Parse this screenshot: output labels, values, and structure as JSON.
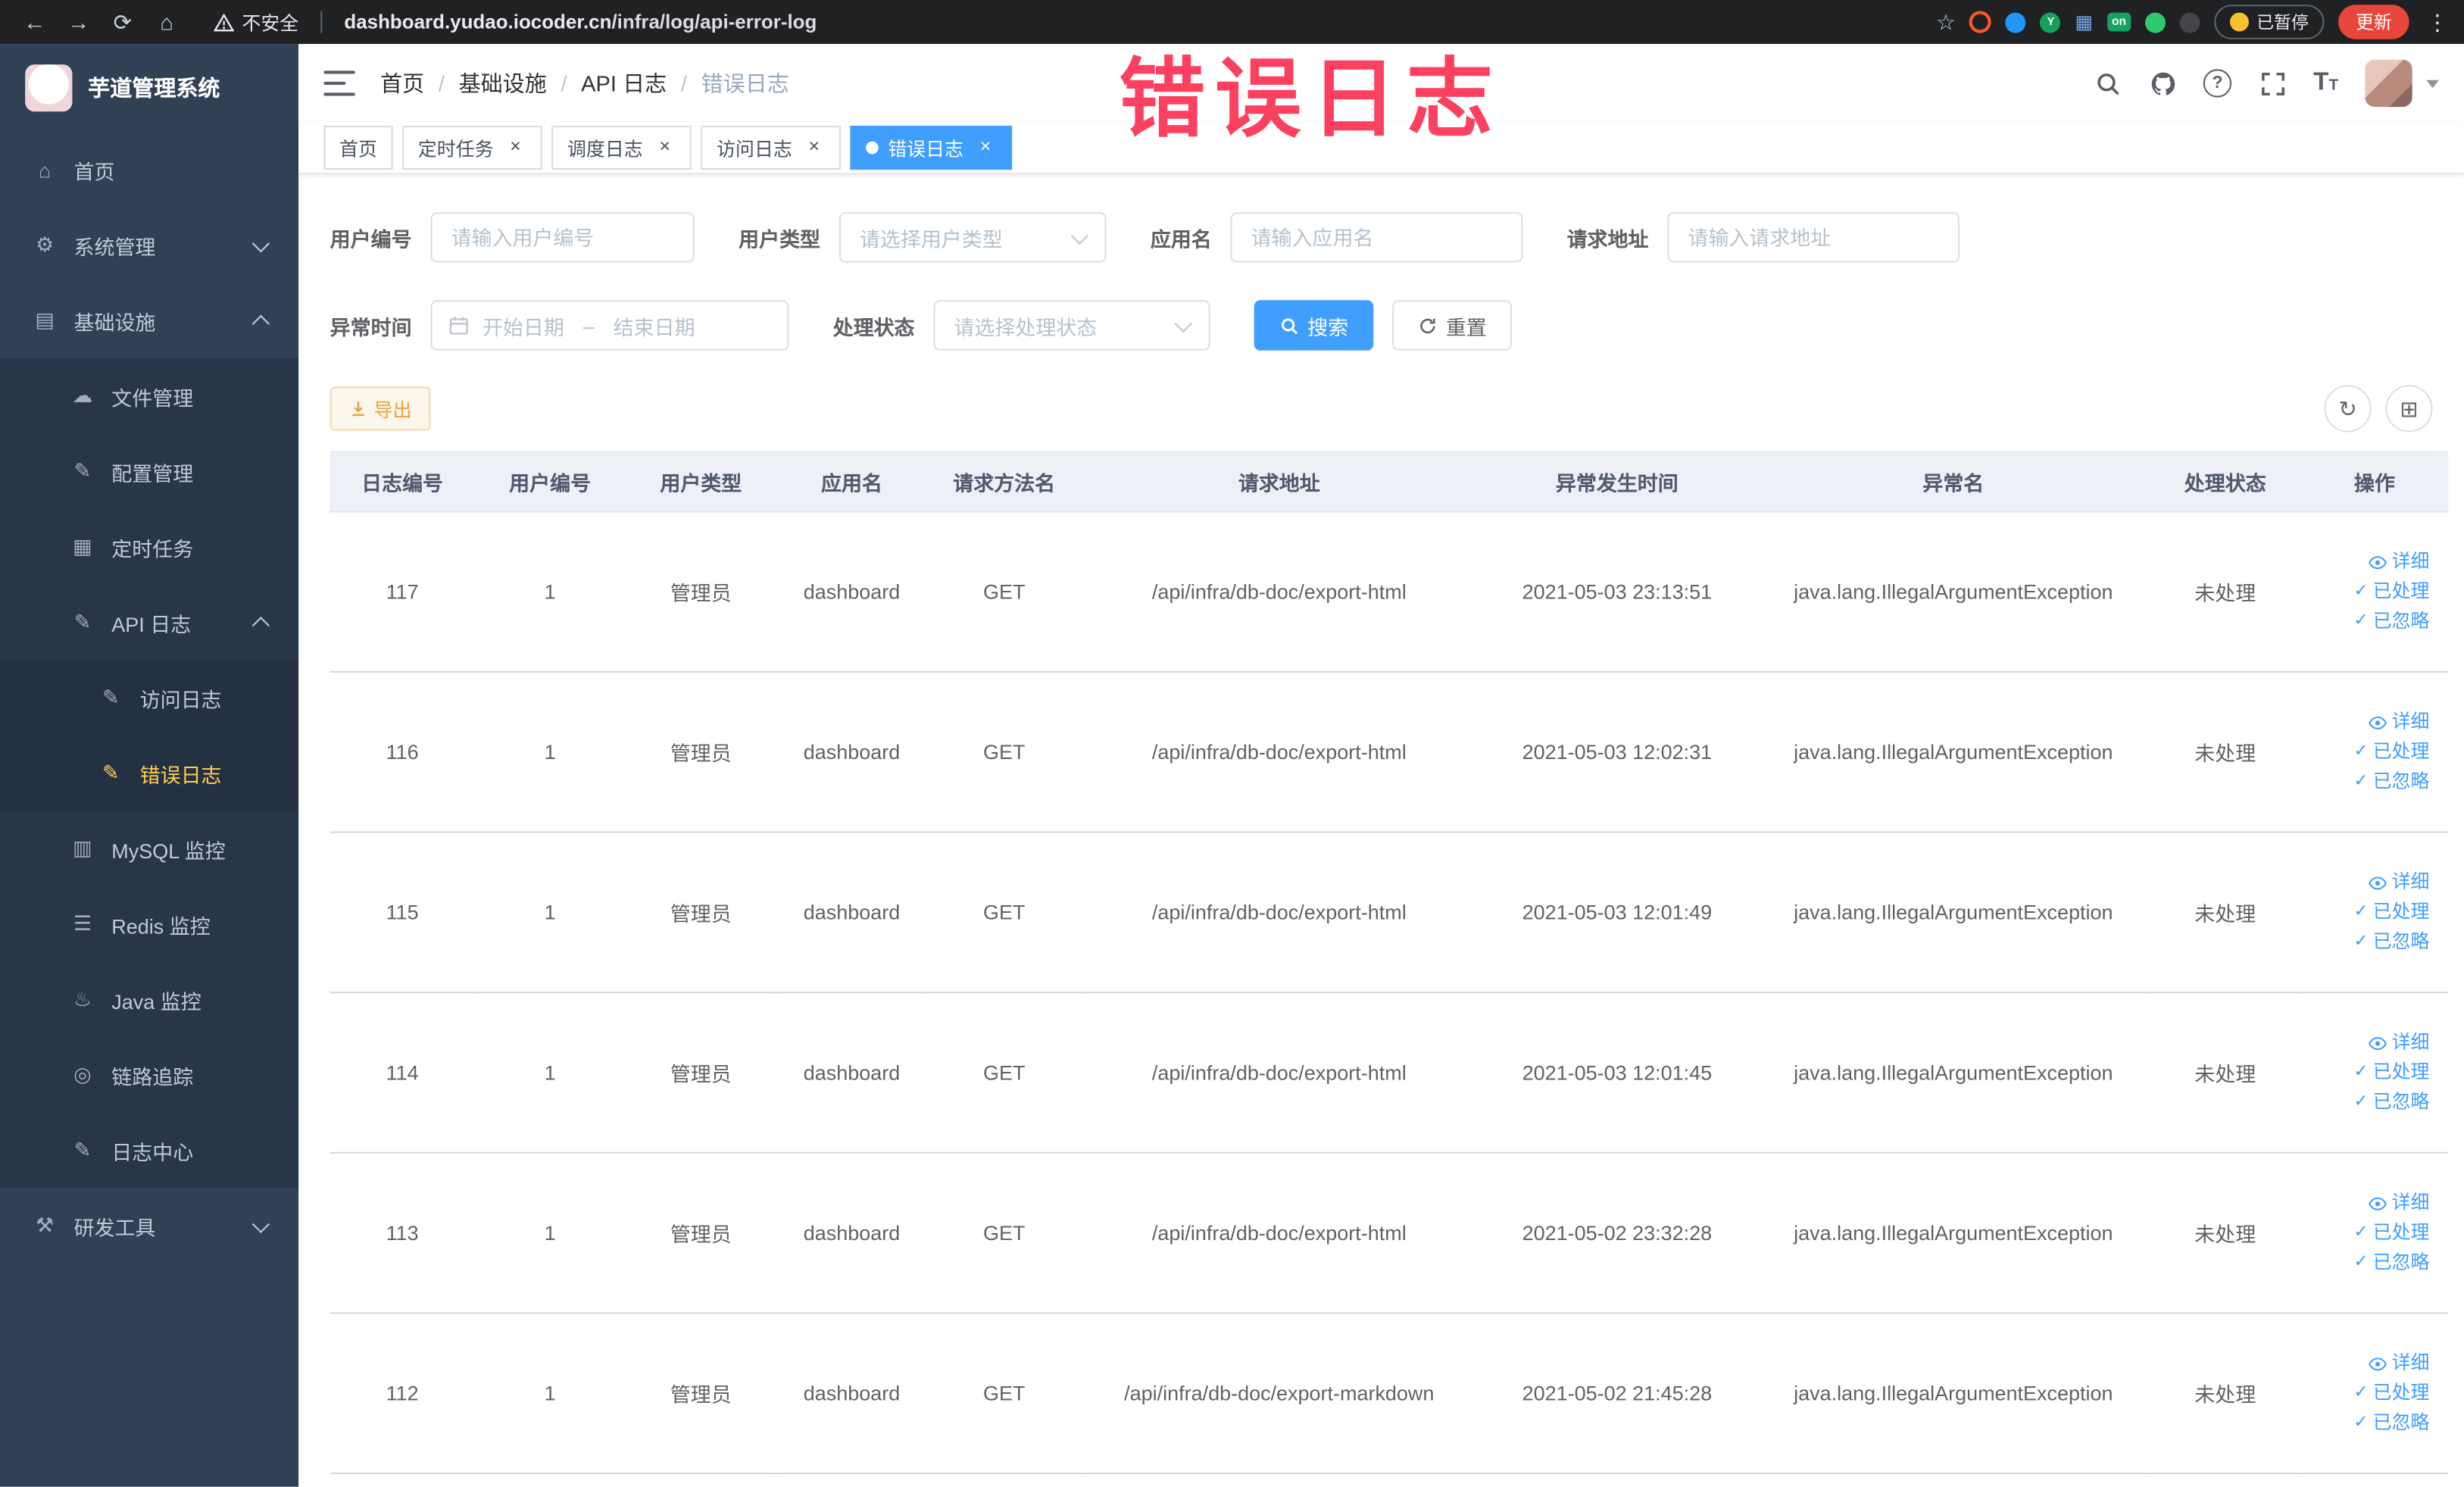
{
  "theme": {
    "accent": "#409eff",
    "sidebar_bg": "#304156",
    "sidebar_active": "#ffd04b",
    "warning": "#e6a23c",
    "watermark_color": "#fb4060",
    "update_red": "#e8453c"
  },
  "icons": {
    "close": "×",
    "more": "⋮",
    "star": "☆",
    "back": "←",
    "forward": "→",
    "reload": "⟳",
    "home": "⌂",
    "refresh": "↻",
    "columns": "⊞",
    "check": "✓"
  },
  "browser": {
    "security_label": "不安全",
    "url_domain": "dashboard.yudao.iocoder.cn",
    "url_path": "/infra/log/api-error-log",
    "paused_badge": "已暂停",
    "update_button": "更新",
    "extension_on_badge": "on",
    "extension_y_badge": "Y"
  },
  "watermark": {
    "text": "错误日志"
  },
  "sidebar": {
    "logo_title": "芋道管理系统",
    "items": [
      {
        "label": "首页",
        "icon_glyph": "⌂"
      },
      {
        "label": "系统管理",
        "icon_glyph": "⚙"
      },
      {
        "label": "基础设施",
        "icon_glyph": "▤"
      },
      {
        "label": "文件管理",
        "icon_glyph": "☁"
      },
      {
        "label": "配置管理",
        "icon_glyph": "✎"
      },
      {
        "label": "定时任务",
        "icon_glyph": "▦"
      },
      {
        "label": "API 日志",
        "icon_glyph": "✎"
      },
      {
        "label": "访问日志",
        "icon_glyph": "✎"
      },
      {
        "label": "错误日志",
        "icon_glyph": "✎"
      },
      {
        "label": "MySQL 监控",
        "icon_glyph": "▥"
      },
      {
        "label": "Redis 监控",
        "icon_glyph": "☰"
      },
      {
        "label": "Java 监控",
        "icon_glyph": "♨"
      },
      {
        "label": "链路追踪",
        "icon_glyph": "◎"
      },
      {
        "label": "日志中心",
        "icon_glyph": "✎"
      },
      {
        "label": "研发工具",
        "icon_glyph": "⚒"
      }
    ]
  },
  "navbar": {
    "breadcrumb": [
      "首页",
      "基础设施",
      "API 日志",
      "错误日志"
    ],
    "separator": "/"
  },
  "tabs": [
    {
      "label": "首页"
    },
    {
      "label": "定时任务"
    },
    {
      "label": "调度日志"
    },
    {
      "label": "访问日志"
    },
    {
      "label": "错误日志"
    }
  ],
  "filters": {
    "user_id": {
      "label": "用户编号",
      "placeholder": "请输入用户编号"
    },
    "user_type": {
      "label": "用户类型",
      "placeholder": "请选择用户类型"
    },
    "app_name": {
      "label": "应用名",
      "placeholder": "请输入应用名"
    },
    "request_url": {
      "label": "请求地址",
      "placeholder": "请输入请求地址"
    },
    "exception_time": {
      "label": "异常时间",
      "start_placeholder": "开始日期",
      "separator": "–",
      "end_placeholder": "结束日期"
    },
    "process_status": {
      "label": "处理状态",
      "placeholder": "请选择处理状态"
    },
    "search_button": "搜索",
    "reset_button": "重置"
  },
  "toolbar": {
    "export_button": "导出"
  },
  "table": {
    "columns": [
      "日志编号",
      "用户编号",
      "用户类型",
      "应用名",
      "请求方法名",
      "请求地址",
      "异常发生时间",
      "异常名",
      "处理状态",
      "操作"
    ],
    "actions": [
      "详细",
      "已处理",
      "已忽略"
    ],
    "rows": [
      {
        "id": "117",
        "user_id": "1",
        "user_type": "管理员",
        "app_name": "dashboard",
        "method": "GET",
        "url": "/api/infra/db-doc/export-html",
        "time": "2021-05-03 23:13:51",
        "exception": "java.lang.IllegalArgumentException",
        "status": "未处理"
      },
      {
        "id": "116",
        "user_id": "1",
        "user_type": "管理员",
        "app_name": "dashboard",
        "method": "GET",
        "url": "/api/infra/db-doc/export-html",
        "time": "2021-05-03 12:02:31",
        "exception": "java.lang.IllegalArgumentException",
        "status": "未处理"
      },
      {
        "id": "115",
        "user_id": "1",
        "user_type": "管理员",
        "app_name": "dashboard",
        "method": "GET",
        "url": "/api/infra/db-doc/export-html",
        "time": "2021-05-03 12:01:49",
        "exception": "java.lang.IllegalArgumentException",
        "status": "未处理"
      },
      {
        "id": "114",
        "user_id": "1",
        "user_type": "管理员",
        "app_name": "dashboard",
        "method": "GET",
        "url": "/api/infra/db-doc/export-html",
        "time": "2021-05-03 12:01:45",
        "exception": "java.lang.IllegalArgumentException",
        "status": "未处理"
      },
      {
        "id": "113",
        "user_id": "1",
        "user_type": "管理员",
        "app_name": "dashboard",
        "method": "GET",
        "url": "/api/infra/db-doc/export-html",
        "time": "2021-05-02 23:32:28",
        "exception": "java.lang.IllegalArgumentException",
        "status": "未处理"
      },
      {
        "id": "112",
        "user_id": "1",
        "user_type": "管理员",
        "app_name": "dashboard",
        "method": "GET",
        "url": "/api/infra/db-doc/export-markdown",
        "time": "2021-05-02 21:45:28",
        "exception": "java.lang.IllegalArgumentException",
        "status": "未处理"
      }
    ]
  }
}
